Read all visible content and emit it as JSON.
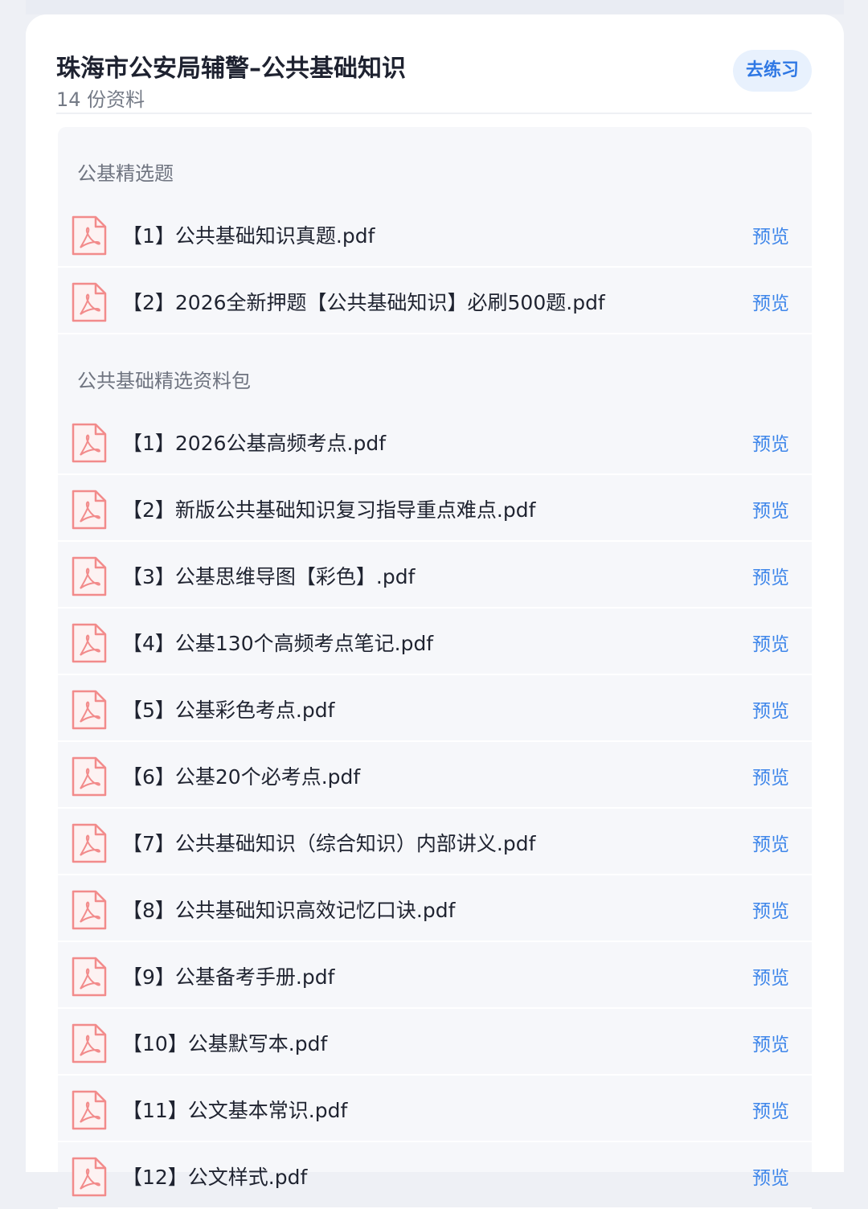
{
  "header": {
    "title": "珠海市公安局辅警–公共基础知识",
    "subtitle": "14 份资料",
    "practice_label": "去练习"
  },
  "sections": [
    {
      "label": "公基精选题",
      "files": [
        {
          "name": "【1】公共基础知识真题.pdf",
          "action": "预览"
        },
        {
          "name": "【2】2026全新押题【公共基础知识】必刷500题.pdf",
          "action": "预览"
        }
      ]
    },
    {
      "label": "公共基础精选资料包",
      "files": [
        {
          "name": "【1】2026公基高频考点.pdf",
          "action": "预览"
        },
        {
          "name": "【2】新版公共基础知识复习指导重点难点.pdf",
          "action": "预览"
        },
        {
          "name": "【3】公基思维导图【彩色】.pdf",
          "action": "预览"
        },
        {
          "name": "【4】公基130个高频考点笔记.pdf",
          "action": "预览"
        },
        {
          "name": "【5】公基彩色考点.pdf",
          "action": "预览"
        },
        {
          "name": "【6】公基20个必考点.pdf",
          "action": "预览"
        },
        {
          "name": "【7】公共基础知识（综合知识）内部讲义.pdf",
          "action": "预览"
        },
        {
          "name": "【8】公共基础知识高效记忆口诀.pdf",
          "action": "预览"
        },
        {
          "name": "【9】公基备考手册.pdf",
          "action": "预览"
        },
        {
          "name": "【10】公基默写本.pdf",
          "action": "预览"
        },
        {
          "name": "【11】公文基本常识.pdf",
          "action": "预览"
        },
        {
          "name": "【12】公文样式.pdf",
          "action": "预览"
        }
      ]
    }
  ],
  "colors": {
    "accent": "#3e86ea",
    "pdf_icon": "#f28b8b"
  },
  "icons": {
    "file": "pdf-file-icon"
  }
}
